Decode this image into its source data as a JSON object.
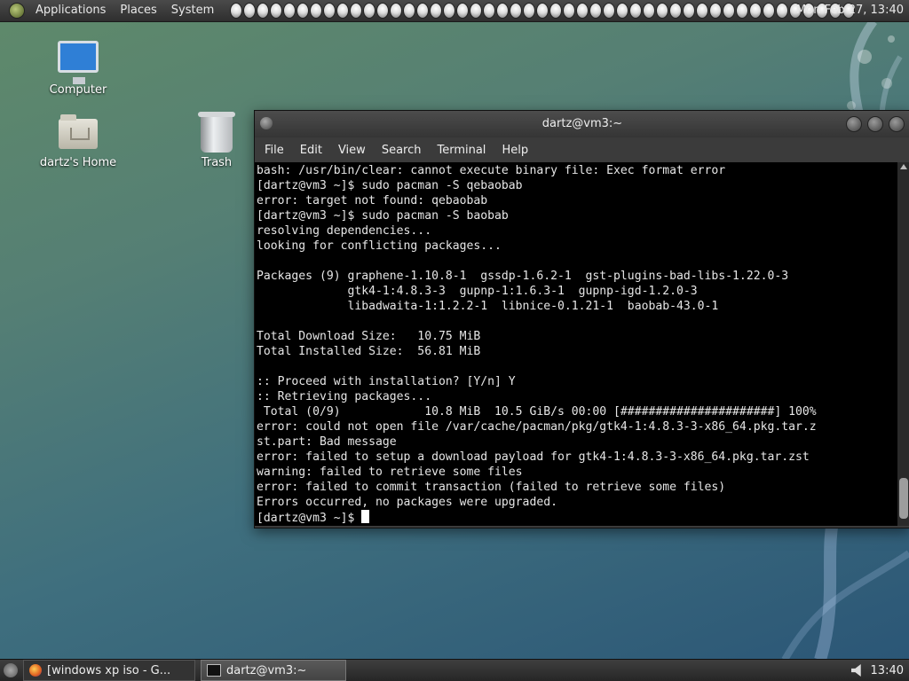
{
  "top_panel": {
    "menus": [
      "Applications",
      "Places",
      "System"
    ],
    "clock": "Mon Feb 27, 13:40"
  },
  "desktop_icons": {
    "computer": "Computer",
    "home": "dartz's Home",
    "trash": "Trash"
  },
  "terminal": {
    "title": "dartz@vm3:~",
    "menu": [
      "File",
      "Edit",
      "View",
      "Search",
      "Terminal",
      "Help"
    ],
    "lines": [
      "bash: /usr/bin/clear: cannot execute binary file: Exec format error",
      "[dartz@vm3 ~]$ sudo pacman -S qebaobab",
      "error: target not found: qebaobab",
      "[dartz@vm3 ~]$ sudo pacman -S baobab",
      "resolving dependencies...",
      "looking for conflicting packages...",
      "",
      "Packages (9) graphene-1.10.8-1  gssdp-1.6.2-1  gst-plugins-bad-libs-1.22.0-3",
      "             gtk4-1:4.8.3-3  gupnp-1:1.6.3-1  gupnp-igd-1.2.0-3",
      "             libadwaita-1:1.2.2-1  libnice-0.1.21-1  baobab-43.0-1",
      "",
      "Total Download Size:   10.75 MiB",
      "Total Installed Size:  56.81 MiB",
      "",
      ":: Proceed with installation? [Y/n] Y",
      ":: Retrieving packages...",
      " Total (0/9)            10.8 MiB  10.5 GiB/s 00:00 [######################] 100%",
      "error: could not open file /var/cache/pacman/pkg/gtk4-1:4.8.3-3-x86_64.pkg.tar.z",
      "st.part: Bad message",
      "error: failed to setup a download payload for gtk4-1:4.8.3-3-x86_64.pkg.tar.zst",
      "warning: failed to retrieve some files",
      "error: failed to commit transaction (failed to retrieve some files)",
      "Errors occurred, no packages were upgraded."
    ],
    "prompt": "[dartz@vm3 ~]$ "
  },
  "taskbar": {
    "tasks": [
      "[windows xp iso - G...",
      "dartz@vm3:~"
    ],
    "time": "13:40"
  }
}
